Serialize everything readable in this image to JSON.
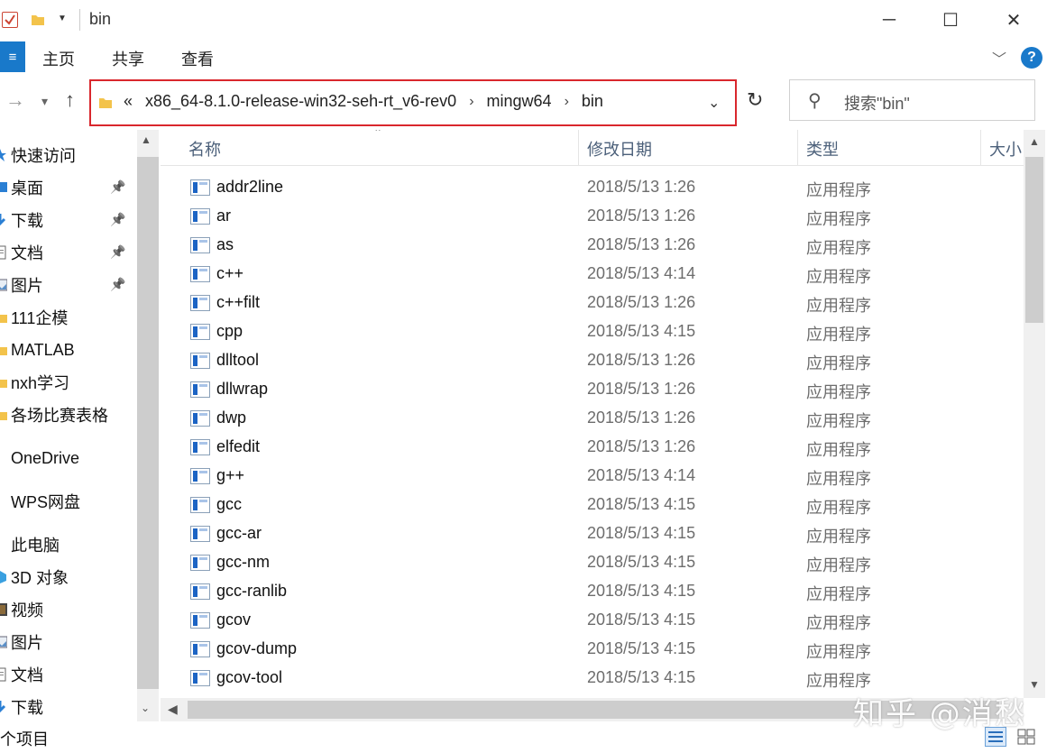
{
  "window": {
    "title": "bin"
  },
  "ribbon": {
    "file_tab": "≡",
    "tabs": [
      "主页",
      "共享",
      "查看"
    ],
    "help": "?"
  },
  "addressbar": {
    "overflow": "«",
    "crumbs": [
      "x86_64-8.1.0-release-win32-seh-rt_v6-rev0",
      "mingw64",
      "bin"
    ]
  },
  "search": {
    "placeholder": "搜索\"bin\""
  },
  "navpane": {
    "items": [
      {
        "label": "快速访问",
        "icon": "star-icon",
        "pinned": false
      },
      {
        "label": "桌面",
        "icon": "desktop-icon",
        "pinned": true
      },
      {
        "label": "下载",
        "icon": "download-icon",
        "pinned": true
      },
      {
        "label": "文档",
        "icon": "document-icon",
        "pinned": true
      },
      {
        "label": "图片",
        "icon": "pictures-icon",
        "pinned": true
      },
      {
        "label": "111企模",
        "icon": "folder-icon",
        "pinned": false
      },
      {
        "label": "MATLAB",
        "icon": "folder-icon",
        "pinned": false
      },
      {
        "label": "nxh学习",
        "icon": "folder-icon",
        "pinned": false
      },
      {
        "label": "各场比赛表格",
        "icon": "folder-icon",
        "pinned": false
      },
      {
        "label": "OneDrive",
        "icon": "cloud-icon",
        "pinned": false
      },
      {
        "label": "WPS网盘",
        "icon": "cloud-icon",
        "pinned": false
      },
      {
        "label": "此电脑",
        "icon": "computer-icon",
        "pinned": false
      },
      {
        "label": "3D 对象",
        "icon": "cube-icon",
        "pinned": false
      },
      {
        "label": "视频",
        "icon": "video-icon",
        "pinned": false
      },
      {
        "label": "图片",
        "icon": "pictures-icon",
        "pinned": false
      },
      {
        "label": "文档",
        "icon": "document-icon",
        "pinned": false
      },
      {
        "label": "下载",
        "icon": "download-icon",
        "pinned": false
      }
    ]
  },
  "filelist": {
    "columns": [
      "名称",
      "修改日期",
      "类型",
      "大小"
    ],
    "rows": [
      {
        "name": "addr2line",
        "date": "2018/5/13 1:26",
        "type": "应用程序"
      },
      {
        "name": "ar",
        "date": "2018/5/13 1:26",
        "type": "应用程序"
      },
      {
        "name": "as",
        "date": "2018/5/13 1:26",
        "type": "应用程序"
      },
      {
        "name": "c++",
        "date": "2018/5/13 4:14",
        "type": "应用程序"
      },
      {
        "name": "c++filt",
        "date": "2018/5/13 1:26",
        "type": "应用程序"
      },
      {
        "name": "cpp",
        "date": "2018/5/13 4:15",
        "type": "应用程序"
      },
      {
        "name": "dlltool",
        "date": "2018/5/13 1:26",
        "type": "应用程序"
      },
      {
        "name": "dllwrap",
        "date": "2018/5/13 1:26",
        "type": "应用程序"
      },
      {
        "name": "dwp",
        "date": "2018/5/13 1:26",
        "type": "应用程序"
      },
      {
        "name": "elfedit",
        "date": "2018/5/13 1:26",
        "type": "应用程序"
      },
      {
        "name": "g++",
        "date": "2018/5/13 4:14",
        "type": "应用程序"
      },
      {
        "name": "gcc",
        "date": "2018/5/13 4:15",
        "type": "应用程序"
      },
      {
        "name": "gcc-ar",
        "date": "2018/5/13 4:15",
        "type": "应用程序"
      },
      {
        "name": "gcc-nm",
        "date": "2018/5/13 4:15",
        "type": "应用程序"
      },
      {
        "name": "gcc-ranlib",
        "date": "2018/5/13 4:15",
        "type": "应用程序"
      },
      {
        "name": "gcov",
        "date": "2018/5/13 4:15",
        "type": "应用程序"
      },
      {
        "name": "gcov-dump",
        "date": "2018/5/13 4:15",
        "type": "应用程序"
      },
      {
        "name": "gcov-tool",
        "date": "2018/5/13 4:15",
        "type": "应用程序"
      }
    ]
  },
  "statusbar": {
    "count": "个项目"
  },
  "watermark": "知乎 @消愁",
  "colors": {
    "accent": "#1979ca",
    "highlight_border": "#d9272d",
    "header_text": "#4c607a",
    "secondary_text": "#6d6d6d"
  }
}
